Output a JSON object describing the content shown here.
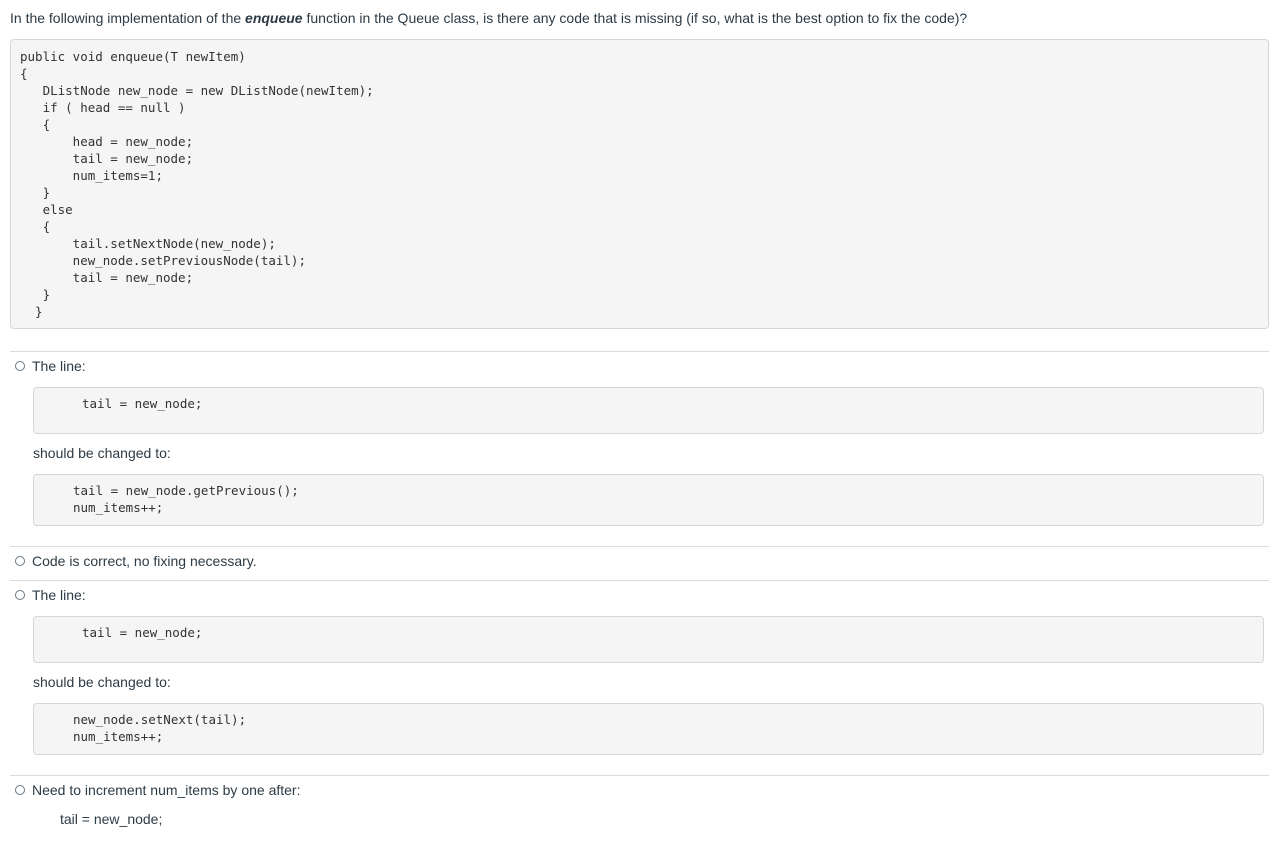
{
  "question": {
    "prefix": "In the following implementation of the ",
    "emphasis": "enqueue",
    "suffix": " function in the Queue class, is there any code that is missing (if so, what is the best option to fix the code)?"
  },
  "main_code": "public void enqueue(T newItem)\n{\n   DListNode new_node = new DListNode(newItem);\n   if ( head == null )\n   {\n       head = new_node;\n       tail = new_node;\n       num_items=1;\n   }\n   else\n   {\n       tail.setNextNode(new_node);\n       new_node.setPreviousNode(tail);\n       tail = new_node;\n   }\n  }",
  "options": [
    {
      "label": "The line:",
      "code_before": "tail = new_node;",
      "middle": "should be changed to:",
      "code_after": "tail = new_node.getPrevious();\nnum_items++;"
    },
    {
      "label": "Code is correct, no fixing necessary."
    },
    {
      "label": "The line:",
      "code_before": "tail = new_node;",
      "middle": "should be changed to:",
      "code_after": "new_node.setNext(tail);\nnum_items++;"
    },
    {
      "label": "Need to increment num_items by one after:",
      "trailing": "tail = new_node;"
    }
  ]
}
